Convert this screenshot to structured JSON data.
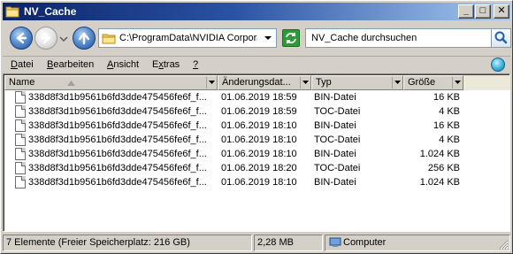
{
  "window": {
    "title": "NV_Cache"
  },
  "titlebar": {
    "minimize": "_",
    "maximize": "□",
    "close": "✕"
  },
  "nav": {
    "address": "C:\\ProgramData\\NVIDIA Corporat",
    "search_placeholder": "NV_Cache durchsuchen"
  },
  "menu": [
    {
      "label": "Datei",
      "u": "D",
      "rest": "atei"
    },
    {
      "label": "Bearbeiten",
      "u": "B",
      "rest": "earbeiten"
    },
    {
      "label": "Ansicht",
      "u": "A",
      "rest": "nsicht"
    },
    {
      "label": "Extras",
      "u": "x",
      "pre": "E",
      "rest": "tras"
    },
    {
      "label": "?",
      "u": "?",
      "rest": ""
    }
  ],
  "columns": [
    {
      "label": "Name"
    },
    {
      "label": "Änderungsdat..."
    },
    {
      "label": "Typ"
    },
    {
      "label": "Größe"
    }
  ],
  "files": [
    {
      "name": "338d8f3d1b9561b6fd3dde475456fe6f_f...",
      "date": "01.06.2019 18:59",
      "type": "BIN-Datei",
      "size": "16 KB"
    },
    {
      "name": "338d8f3d1b9561b6fd3dde475456fe6f_f...",
      "date": "01.06.2019 18:59",
      "type": "TOC-Datei",
      "size": "4 KB"
    },
    {
      "name": "338d8f3d1b9561b6fd3dde475456fe6f_f...",
      "date": "01.06.2019 18:10",
      "type": "BIN-Datei",
      "size": "16 KB"
    },
    {
      "name": "338d8f3d1b9561b6fd3dde475456fe6f_f...",
      "date": "01.06.2019 18:10",
      "type": "TOC-Datei",
      "size": "4 KB"
    },
    {
      "name": "338d8f3d1b9561b6fd3dde475456fe6f_f...",
      "date": "01.06.2019 18:10",
      "type": "BIN-Datei",
      "size": "1.024 KB"
    },
    {
      "name": "338d8f3d1b9561b6fd3dde475456fe6f_f...",
      "date": "01.06.2019 18:20",
      "type": "TOC-Datei",
      "size": "256 KB"
    },
    {
      "name": "338d8f3d1b9561b6fd3dde475456fe6f_f...",
      "date": "01.06.2019 18:10",
      "type": "BIN-Datei",
      "size": "1.024 KB"
    }
  ],
  "status": {
    "items": "7 Elemente (Freier Speicherplatz: 216 GB)",
    "size": "2,28 MB",
    "location": "Computer"
  },
  "icons": {
    "title": "folder-icon",
    "back": "back-arrow-icon",
    "forward": "forward-arrow-icon",
    "up": "up-arrow-icon",
    "refresh": "refresh-icon",
    "search": "search-icon",
    "help": "help-globe-icon",
    "file": "file-icon",
    "computer": "computer-icon"
  }
}
